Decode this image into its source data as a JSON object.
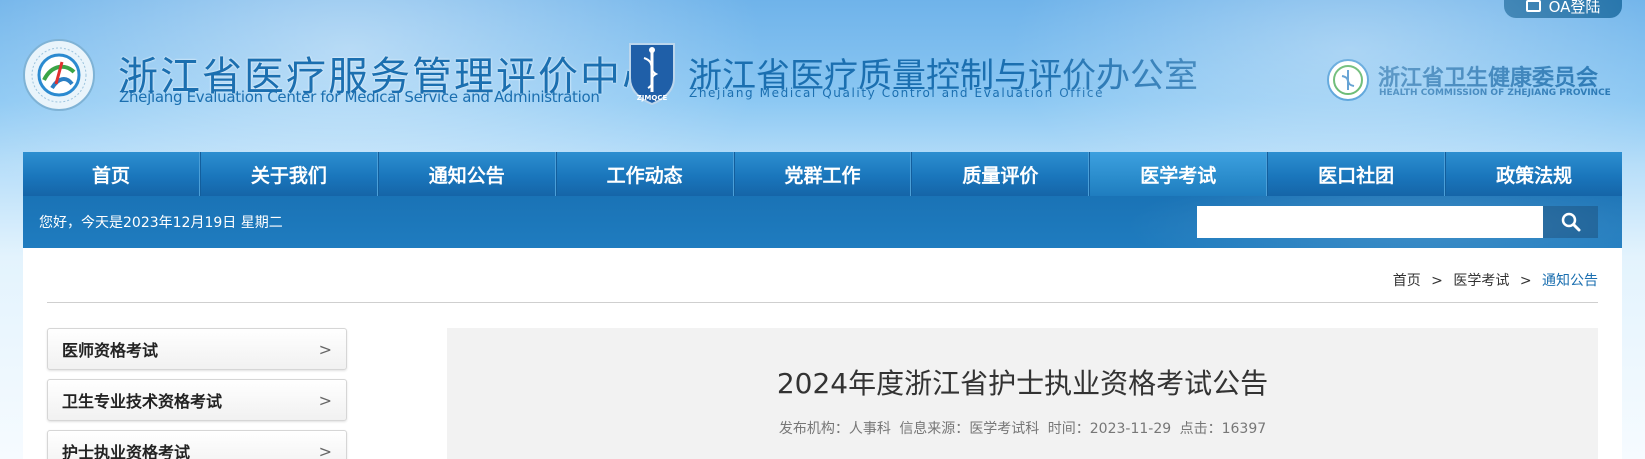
{
  "header": {
    "oa_label": "OA登陆",
    "center_cn": "浙江省医疗服务管理评价中心",
    "center_en": "Zhejiang Evaluation Center for Medical Service and Administration",
    "office_cn": "浙江省医疗质量控制与评价办公室",
    "office_en": "Zhejiang Medical Quality Control and Evaluation Office",
    "office_badge": "ZJMQCE",
    "commission_cn": "浙江省卫生健康委员会",
    "commission_en": "HEALTH COMMISSION OF ZHEJIANG PROVINCE"
  },
  "nav": {
    "items": [
      {
        "label": "首页"
      },
      {
        "label": "关于我们"
      },
      {
        "label": "通知公告"
      },
      {
        "label": "工作动态"
      },
      {
        "label": "党群工作"
      },
      {
        "label": "质量评价"
      },
      {
        "label": "医学考试"
      },
      {
        "label": "医口社团"
      },
      {
        "label": "政策法规"
      }
    ],
    "active_index": 6
  },
  "subbar": {
    "greeting": "您好，今天是2023年12月19日 星期二",
    "search_placeholder": "",
    "search_icon": "search-icon"
  },
  "breadcrumb": {
    "home": "首页",
    "level2": "医学考试",
    "current": "通知公告",
    "sep": ">"
  },
  "sidebar": {
    "items": [
      {
        "label": "医师资格考试"
      },
      {
        "label": "卫生专业技术资格考试"
      },
      {
        "label": "护士执业资格考试"
      }
    ],
    "chevron": ">"
  },
  "article": {
    "title": "2024年度浙江省护士执业资格考试公告",
    "publisher_label": "发布机构：",
    "publisher": "人事科",
    "source_label": "信息来源：",
    "source": "医学考试科",
    "time_label": "时间：",
    "time": "2023-11-29",
    "clicks_label": "点击：",
    "clicks": "16397"
  },
  "colors": {
    "brand_blue": "#1b6fb0",
    "nav_blue": "#1a76bc",
    "nav_active": "#2a8ccc"
  }
}
